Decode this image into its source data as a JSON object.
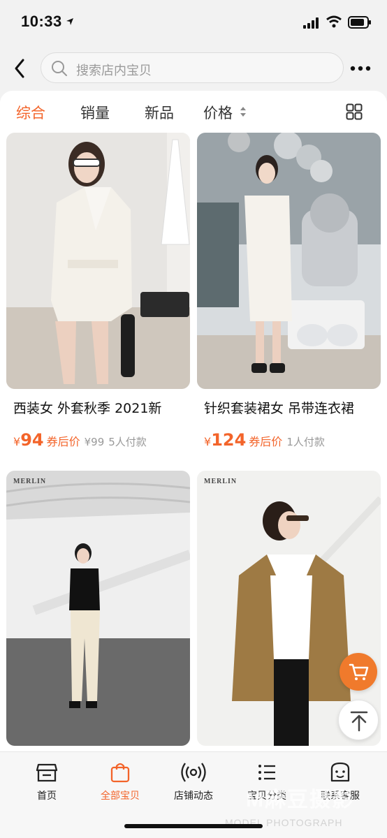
{
  "status_bar": {
    "time": "10:33"
  },
  "search": {
    "placeholder": "搜索店内宝贝"
  },
  "sort_tabs": [
    {
      "label": "综合",
      "active": true
    },
    {
      "label": "销量",
      "active": false
    },
    {
      "label": "新品",
      "active": false
    },
    {
      "label": "价格",
      "active": false
    }
  ],
  "products": [
    {
      "title": "西装女 外套秋季 2021新",
      "currency": "¥",
      "price": "94",
      "price_tag": "券后价",
      "original_price": "¥99",
      "sold": "5人付款",
      "image_desc": "white-blazer-dress"
    },
    {
      "title": "针织套装裙女 吊带连衣裙",
      "currency": "¥",
      "price": "124",
      "price_tag": "券后价",
      "original_price": "",
      "sold": "1人付款",
      "image_desc": "knit-dress-balloons"
    },
    {
      "brand": "MERLIN",
      "image_desc": "black-top-cream-pants"
    },
    {
      "brand": "MERLIN",
      "image_desc": "camel-blazer-white-shirt"
    }
  ],
  "bottom_nav": [
    {
      "label": "首页",
      "icon": "shop-icon",
      "active": false
    },
    {
      "label": "全部宝贝",
      "icon": "bag-icon",
      "active": true
    },
    {
      "label": "店铺动态",
      "icon": "broadcast-icon",
      "active": false
    },
    {
      "label": "宝贝分类",
      "icon": "list-icon",
      "active": false
    },
    {
      "label": "联系客服",
      "icon": "service-icon",
      "active": false
    }
  ],
  "watermark": {
    "main": "M麻豆摄影",
    "sub": "MODEL PHOTOGRAPH"
  },
  "colors": {
    "accent": "#f3642a",
    "fab": "#f07a2c",
    "background": "#f2f2f2"
  }
}
